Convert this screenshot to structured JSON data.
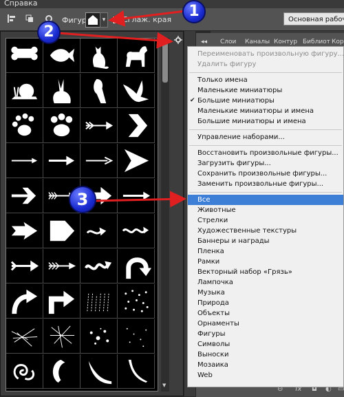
{
  "menubar": {
    "label": "Справка"
  },
  "options_bar": {
    "shape_label": "Фигура:",
    "smooth_label": "Сглаж. края",
    "workspace_label": "Основная рабочая сре"
  },
  "panel_tabs": [
    "Слои",
    "Каналы",
    "Контур",
    "Библиот",
    "Кор"
  ],
  "shapes": [
    "bone",
    "fish",
    "cat",
    "dog",
    "snail",
    "rabbit",
    "parrot",
    "dove",
    "paw-print-1",
    "paw-print-2",
    "arrow-feathered",
    "chevron-arrow",
    "arrow-thin",
    "arrow-thin-2",
    "arrow-thin-3",
    "arrow-wide-triangle",
    "arrow-block",
    "arrow-feathered-2",
    "arrow-heavy",
    "arrow-thin-4",
    "arrow-notched",
    "arrow-pentagon",
    "arrow-curvy-small",
    "arrow-wavy",
    "arrow-feathered-3",
    "arrow-feathered-4",
    "arrow-squiggle",
    "arrow-u-turn",
    "arrow-curved",
    "arrow-corner",
    "texture-grass",
    "texture-dots",
    "texture-scratch",
    "texture-lines",
    "texture-splatter",
    "texture-spots",
    "ornament-swirl",
    "banner-curl",
    "banner-crescent",
    "banner-scroll"
  ],
  "menu": [
    {
      "type": "item",
      "label": "Переименовать произвольную фигуру...",
      "enabled": false
    },
    {
      "type": "item",
      "label": "Удалить фигуру",
      "enabled": false
    },
    {
      "type": "separator"
    },
    {
      "type": "item",
      "label": "Только имена"
    },
    {
      "type": "item",
      "label": "Маленькие миниатюры"
    },
    {
      "type": "item",
      "label": "Большие миниатюры",
      "checked": true
    },
    {
      "type": "item",
      "label": "Маленькие миниатюры и имена"
    },
    {
      "type": "item",
      "label": "Большие миниатюры и имена"
    },
    {
      "type": "separator"
    },
    {
      "type": "item",
      "label": "Управление наборами..."
    },
    {
      "type": "separator"
    },
    {
      "type": "item",
      "label": "Восстановить произвольные фигуры..."
    },
    {
      "type": "item",
      "label": "Загрузить фигуры..."
    },
    {
      "type": "item",
      "label": "Сохранить произвольные фигуры..."
    },
    {
      "type": "item",
      "label": "Заменить произвольные фигуры..."
    },
    {
      "type": "separator"
    },
    {
      "type": "item",
      "label": "Все",
      "highlighted": true
    },
    {
      "type": "item",
      "label": "Животные"
    },
    {
      "type": "item",
      "label": "Стрелки"
    },
    {
      "type": "item",
      "label": "Художественные текстуры"
    },
    {
      "type": "item",
      "label": "Баннеры и награды"
    },
    {
      "type": "item",
      "label": "Пленка"
    },
    {
      "type": "item",
      "label": "Рамки"
    },
    {
      "type": "item",
      "label": "Векторный набор «Грязь»"
    },
    {
      "type": "item",
      "label": "Лампочка"
    },
    {
      "type": "item",
      "label": "Музыка"
    },
    {
      "type": "item",
      "label": "Природа"
    },
    {
      "type": "item",
      "label": "Объекты"
    },
    {
      "type": "item",
      "label": "Орнаменты"
    },
    {
      "type": "item",
      "label": "Фигуры"
    },
    {
      "type": "item",
      "label": "Символы"
    },
    {
      "type": "item",
      "label": "Выноски"
    },
    {
      "type": "item",
      "label": "Мозаика"
    },
    {
      "type": "item",
      "label": "Web"
    }
  ],
  "annotations": [
    {
      "label": "1"
    },
    {
      "label": "2"
    },
    {
      "label": "3"
    }
  ],
  "colors": {
    "highlight": "#3d7fd6",
    "arrow_red": "#e02020",
    "badge_blue": "#1a2bd0"
  }
}
